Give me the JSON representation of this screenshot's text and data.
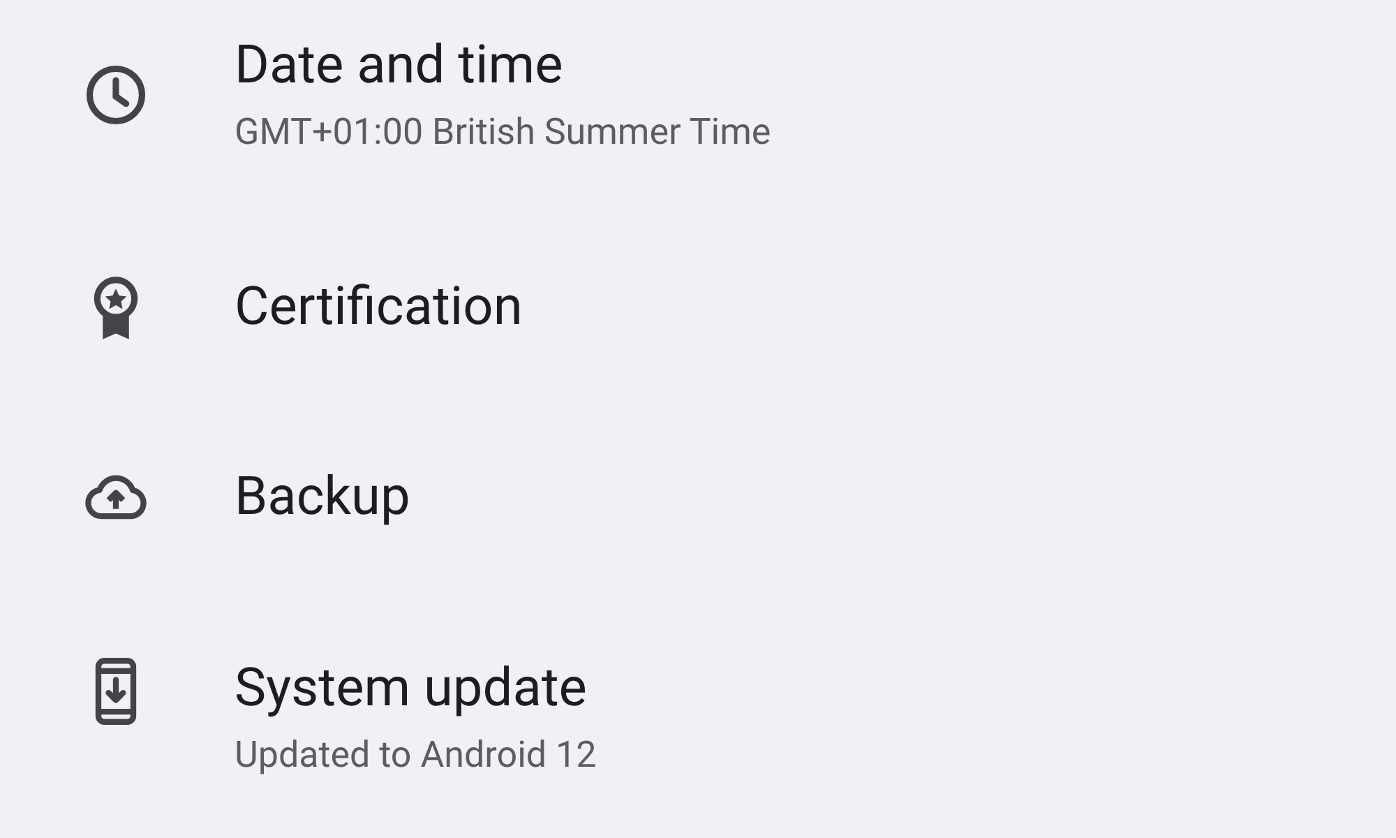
{
  "settings_items": [
    {
      "kind": "clock",
      "title": "Date and time",
      "subtitle": "GMT+01:00 British Summer Time"
    },
    {
      "kind": "certificate",
      "title": "Certification"
    },
    {
      "kind": "cloud",
      "title": "Backup"
    },
    {
      "kind": "phone",
      "title": "System update",
      "subtitle": "Updated to Android 12"
    }
  ]
}
